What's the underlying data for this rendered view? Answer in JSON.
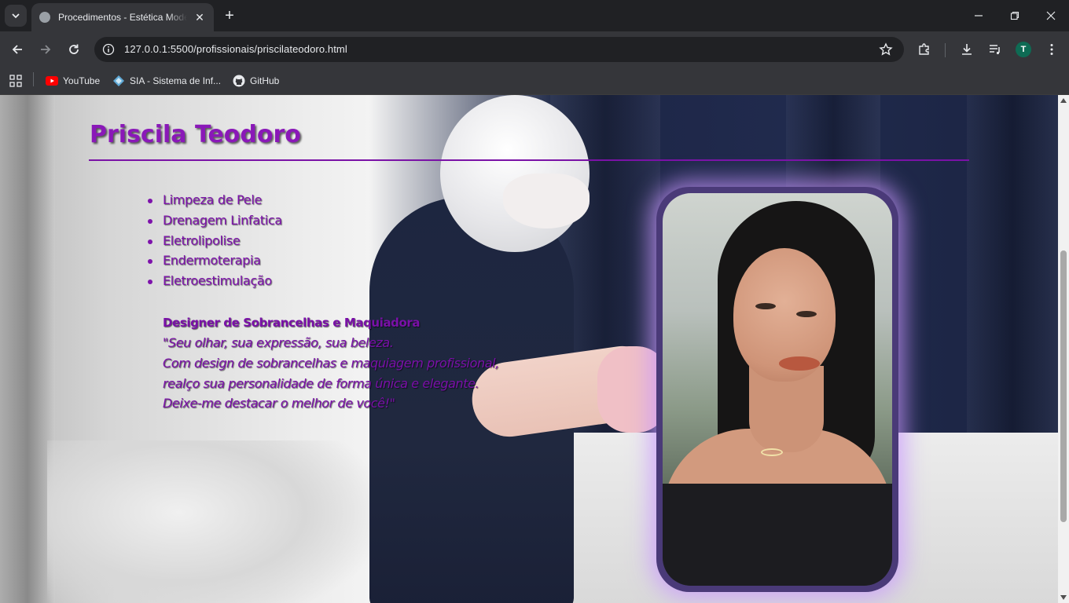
{
  "browser": {
    "tab_title": "Procedimentos - Estética Moderna",
    "url": "127.0.0.1:5500/profissionais/priscilateodoro.html",
    "profile_initial": "T",
    "bookmarks": [
      {
        "label": "YouTube",
        "icon": "youtube-icon"
      },
      {
        "label": "SIA - Sistema de Inf...",
        "icon": "sia-icon"
      },
      {
        "label": "GitHub",
        "icon": "github-icon"
      }
    ]
  },
  "page": {
    "title": "Priscila Teodoro",
    "services": [
      "Limpeza de Pele",
      "Drenagem Linfatica",
      "Eletrolipolise",
      "Endermoterapia",
      "Eletroestimulação"
    ],
    "bio": {
      "role": "Designer de Sobrancelhas e Maquiadora",
      "quote_lines": [
        "\"Seu olhar, sua expressão, sua beleza.",
        "Com design de sobrancelhas e maquiagem profissional,",
        "realço sua personalidade de forma única e elegante.",
        "Deixe-me destacar o melhor de você!\""
      ]
    },
    "accent_color": "#8a18b8",
    "glow_color": "#c896ff"
  }
}
